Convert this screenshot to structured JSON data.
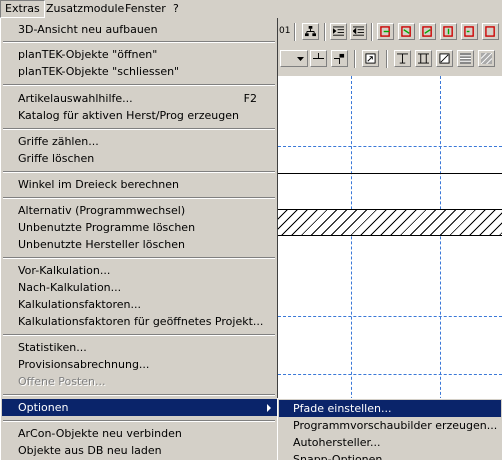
{
  "menubar": {
    "items": [
      "Extras",
      "Zusatzmodule",
      "Fenster",
      "?"
    ]
  },
  "toolbar": {
    "partial_label": "01"
  },
  "menu": {
    "items": [
      {
        "label": "3D-Ansicht neu aufbauen"
      },
      {
        "label": "planTEK-Objekte \"öffnen\""
      },
      {
        "label": "planTEK-Objekte \"schliessen\""
      },
      {
        "label": "Artikelauswahlhilfe...",
        "shortcut": "F2"
      },
      {
        "label": "Katalog für aktiven Herst/Prog erzeugen"
      },
      {
        "label": "Griffe zählen..."
      },
      {
        "label": "Griffe löschen"
      },
      {
        "label": "Winkel im Dreieck berechnen"
      },
      {
        "label": "Alternativ (Programmwechsel)"
      },
      {
        "label": "Unbenutzte Programme löschen"
      },
      {
        "label": "Unbenutzte Hersteller löschen"
      },
      {
        "label": "Vor-Kalkulation..."
      },
      {
        "label": "Nach-Kalkulation..."
      },
      {
        "label": "Kalkulationsfaktoren..."
      },
      {
        "label": "Kalkulationsfaktoren für geöffnetes Projekt..."
      },
      {
        "label": "Statistiken..."
      },
      {
        "label": "Provisionsabrechnung..."
      },
      {
        "label": "Offene Posten...",
        "disabled": true
      },
      {
        "label": "Optionen",
        "submenu": true,
        "selected": true
      },
      {
        "label": "ArCon-Objekte neu verbinden"
      },
      {
        "label": "Objekte aus DB neu laden"
      }
    ]
  },
  "submenu": {
    "items": [
      {
        "label": "Pfade einstellen...",
        "selected": true
      },
      {
        "label": "Programmvorschaubilder erzeugen..."
      },
      {
        "label": "Autohersteller..."
      },
      {
        "label": "Snapp-Optionen"
      }
    ]
  },
  "colors": {
    "menu_bg": "#d4d0c8",
    "highlight": "#0a246a",
    "guide_lines": "#3a78d8"
  }
}
